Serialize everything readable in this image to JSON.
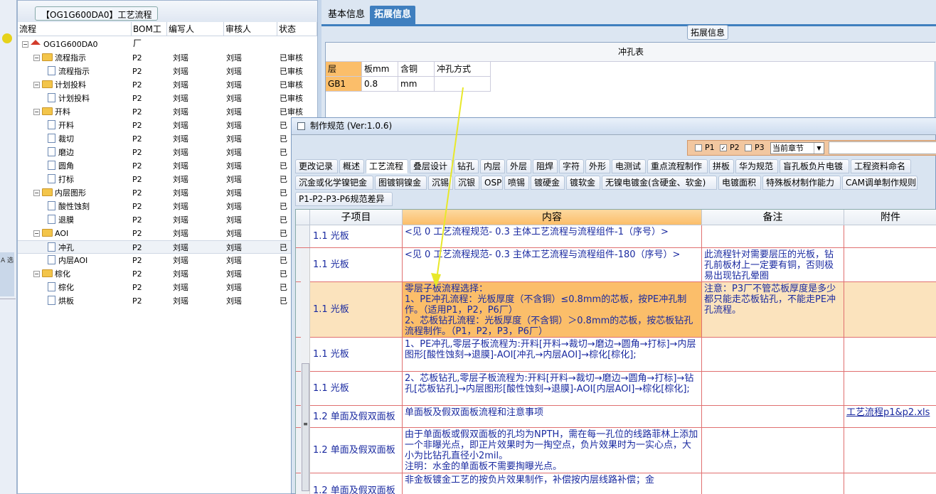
{
  "left_panel": {
    "title": "【OG1G600DA0】工艺流程",
    "columns": [
      "流程",
      "BOM工厂",
      "编写人",
      "审核人",
      "状态"
    ],
    "rows": [
      {
        "label": "OG1G600DA0",
        "type": "root",
        "factory": "",
        "author": "",
        "reviewer": "",
        "status": ""
      },
      {
        "label": "流程指示",
        "type": "folder",
        "factory": "P2",
        "author": "刘瑶",
        "reviewer": "刘瑶",
        "status": "已审核"
      },
      {
        "label": "流程指示",
        "type": "doc",
        "factory": "P2",
        "author": "刘瑶",
        "reviewer": "刘瑶",
        "status": "已审核"
      },
      {
        "label": "计划投料",
        "type": "folder",
        "factory": "P2",
        "author": "刘瑶",
        "reviewer": "刘瑶",
        "status": "已审核"
      },
      {
        "label": "计划投料",
        "type": "doc",
        "factory": "P2",
        "author": "刘瑶",
        "reviewer": "刘瑶",
        "status": "已审核"
      },
      {
        "label": "开料",
        "type": "folder",
        "factory": "P2",
        "author": "刘瑶",
        "reviewer": "刘瑶",
        "status": "已审核"
      },
      {
        "label": "开料",
        "type": "doc",
        "factory": "P2",
        "author": "刘瑶",
        "reviewer": "刘瑶",
        "status": "已"
      },
      {
        "label": "裁切",
        "type": "doc",
        "factory": "P2",
        "author": "刘瑶",
        "reviewer": "刘瑶",
        "status": "已"
      },
      {
        "label": "磨边",
        "type": "doc",
        "factory": "P2",
        "author": "刘瑶",
        "reviewer": "刘瑶",
        "status": "已"
      },
      {
        "label": "圆角",
        "type": "doc",
        "factory": "P2",
        "author": "刘瑶",
        "reviewer": "刘瑶",
        "status": "已"
      },
      {
        "label": "打标",
        "type": "doc",
        "factory": "P2",
        "author": "刘瑶",
        "reviewer": "刘瑶",
        "status": "已"
      },
      {
        "label": "内层图形",
        "type": "folder",
        "factory": "P2",
        "author": "刘瑶",
        "reviewer": "刘瑶",
        "status": "已"
      },
      {
        "label": "酸性蚀刻",
        "type": "doc",
        "factory": "P2",
        "author": "刘瑶",
        "reviewer": "刘瑶",
        "status": "已"
      },
      {
        "label": "退膜",
        "type": "doc",
        "factory": "P2",
        "author": "刘瑶",
        "reviewer": "刘瑶",
        "status": "已"
      },
      {
        "label": "AOI",
        "type": "folder",
        "factory": "P2",
        "author": "刘瑶",
        "reviewer": "刘瑶",
        "status": "已"
      },
      {
        "label": "冲孔",
        "type": "doc",
        "factory": "P2",
        "author": "刘瑶",
        "reviewer": "刘瑶",
        "status": "已",
        "selected": true
      },
      {
        "label": "内层AOI",
        "type": "doc",
        "factory": "P2",
        "author": "刘瑶",
        "reviewer": "刘瑶",
        "status": "已"
      },
      {
        "label": "棕化",
        "type": "folder",
        "factory": "P2",
        "author": "刘瑶",
        "reviewer": "刘瑶",
        "status": "已"
      },
      {
        "label": "棕化",
        "type": "doc",
        "factory": "P2",
        "author": "刘瑶",
        "reviewer": "刘瑶",
        "status": "已"
      },
      {
        "label": "烘板",
        "type": "doc",
        "factory": "P2",
        "author": "刘瑶",
        "reviewer": "刘瑶",
        "status": "已"
      }
    ]
  },
  "side_strip": {
    "text": "A\n选"
  },
  "right_panel": {
    "tabs": [
      "基本信息",
      "拓展信息"
    ],
    "ext_legend": "拓展信息",
    "punch_table": {
      "caption": "冲孔表",
      "headers": [
        "层",
        "板mm",
        "含铜mm",
        "冲孔方式"
      ],
      "row": [
        "GB1",
        "0.8",
        "",
        ""
      ]
    }
  },
  "dialog": {
    "title": "制作规范 (Ver:1.0.6)",
    "filter": {
      "p1": "P1",
      "p2": "P2",
      "p3": "P3",
      "chapter": "当前章节",
      "p2_checked": "✓"
    },
    "tab_row1": [
      "更改记录",
      "概述",
      "工艺流程",
      "叠层设计",
      "钻孔",
      "内层",
      "外层",
      "阻焊",
      "字符",
      "外形",
      "电测试",
      "重点流程制作",
      "拼板",
      "华为规范",
      "盲孔板负片电镀",
      "工程资料命名"
    ],
    "tab_row2": [
      "沉金或化学镍钯金",
      "图镀铜镍金",
      "沉锡",
      "沉银",
      "OSP",
      "喷锡",
      "镀硬金",
      "镀软金",
      "无镍电镀金(含硬金、软金)",
      "电镀面积",
      "特殊板材制作能力",
      "CAM调单制作规则"
    ],
    "tab_row3": [
      "P1-P2-P3-P6规范差异"
    ],
    "grid_headers": [
      "子项目",
      "内容",
      "备注",
      "附件"
    ],
    "rows": [
      {
        "sub": "1.1 光板",
        "content": "<见 0 工艺流程规范- 0.3 主体工艺流程与流程组件-1（序号）>",
        "note": "",
        "attach": ""
      },
      {
        "sub": "1.1 光板",
        "content": "<见 0 工艺流程规范- 0.3 主体工艺流程与流程组件-180（序号）>",
        "note": "此流程针对需要层压的光板，钻孔前板材上一定要有铜，否则极易出现钻孔晕圈",
        "attach": ""
      },
      {
        "sub": "1.1 光板",
        "content": "零层子板流程选择：\n1、PE冲孔流程：光板厚度（不含铜）≤0.8mm的芯板，按PE冲孔制作。（适用P1，P2，P6厂）\n2、芯板钻孔流程：光板厚度（不含铜）＞0.8mm的芯板，按芯板钻孔流程制作。（P1，P2，P3，P6厂）",
        "note": "注意：P3厂不管芯板厚度是多少都只能走芯板钻孔，不能走PE冲孔流程。",
        "attach": "",
        "highlight": true
      },
      {
        "sub": "1.1 光板",
        "content": "1、PE冲孔,零层子板流程为:开料[开料→裁切→磨边→圆角→打标]→内层图形[酸性蚀刻→退膜]-AOI[冲孔→内层AOI]→棕化[棕化];",
        "note": "",
        "attach": ""
      },
      {
        "sub": "1.1 光板",
        "content": "2、芯板钻孔,零层子板流程为:开料[开料→裁切→磨边→圆角→打标]→钻孔[芯板钻孔]→内层图形[酸性蚀刻→退膜]-AOI[内层AOI]→棕化[棕化];",
        "note": "",
        "attach": ""
      },
      {
        "sub": "1.2 单面及假双面板",
        "content": "单面板及假双面板流程和注意事项",
        "note": "",
        "attach": "工艺流程p1&p2.xls"
      },
      {
        "sub": "1.2 单面及假双面板",
        "content": "由于单面板或假双面板的孔均为NPTH，需在每一孔位的线路菲林上添加一个非曝光点，即正片效果时为一掏空点，负片效果时为一实心点，大小为比钻孔直径小2mil。\n注明：水金的单面板不需要掏曝光点。",
        "note": "",
        "attach": ""
      },
      {
        "sub": "1.2 单面及假双面板",
        "content": "非金板镀金工艺的按负片效果制作，补偿按内层线路补偿；金",
        "note": "",
        "attach": ""
      }
    ]
  },
  "colors": {
    "accent": "#3f7fbf",
    "highlight": "#fbbe6a",
    "row_border": "#e07070",
    "text_blue": "#1a2aa0",
    "arrow": "#e8e82a"
  }
}
